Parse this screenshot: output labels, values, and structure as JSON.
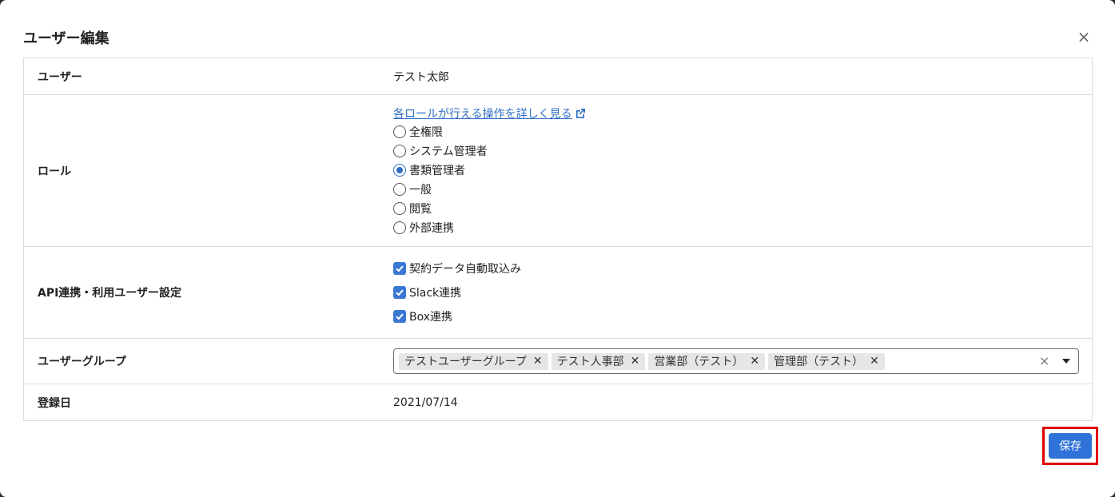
{
  "modal": {
    "title": "ユーザー編集",
    "close_label": "×"
  },
  "rows": {
    "user": {
      "label": "ユーザー",
      "value": "テスト太郎"
    },
    "role": {
      "label": "ロール",
      "link_text": "各ロールが行える操作を詳しく見る",
      "options": [
        {
          "label": "全権限",
          "checked": false
        },
        {
          "label": "システム管理者",
          "checked": false
        },
        {
          "label": "書類管理者",
          "checked": true
        },
        {
          "label": "一般",
          "checked": false
        },
        {
          "label": "閲覧",
          "checked": false
        },
        {
          "label": "外部連携",
          "checked": false
        }
      ]
    },
    "api": {
      "label": "API連携・利用ユーザー設定",
      "options": [
        {
          "label": "契約データ自動取込み",
          "checked": true
        },
        {
          "label": "Slack連携",
          "checked": true
        },
        {
          "label": "Box連携",
          "checked": true
        }
      ]
    },
    "group": {
      "label": "ユーザーグループ",
      "chips": [
        "テストユーザーグループ",
        "テスト人事部",
        "営業部（テスト）",
        "管理部（テスト）"
      ],
      "chip_remove": "✕",
      "clear_all": "×"
    },
    "date": {
      "label": "登録日",
      "value": "2021/07/14"
    }
  },
  "footer": {
    "save_label": "保存"
  },
  "colors": {
    "accent": "#2f73d8",
    "highlight": "#e00000"
  }
}
